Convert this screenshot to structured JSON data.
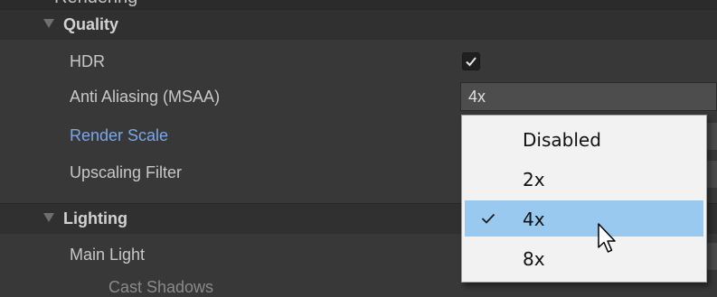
{
  "top_header": {
    "text": "Rendering"
  },
  "quality_section": {
    "title": "Quality",
    "hdr": {
      "label": "HDR",
      "checked": true
    },
    "anti_aliasing": {
      "label": "Anti Aliasing (MSAA)",
      "value": "4x"
    },
    "render_scale": {
      "label": "Render Scale"
    },
    "upscaling_filter": {
      "label": "Upscaling Filter"
    }
  },
  "lighting_section": {
    "title": "Lighting",
    "main_light": {
      "label": "Main Light"
    },
    "cast_shadows": {
      "label": "Cast Shadows"
    }
  },
  "msaa_popup": {
    "options": [
      {
        "label": "Disabled",
        "selected": false
      },
      {
        "label": "2x",
        "selected": false
      },
      {
        "label": "4x",
        "selected": true
      },
      {
        "label": "8x",
        "selected": false
      }
    ]
  },
  "colors": {
    "panel_bg": "#383838",
    "header_bg": "#303030",
    "highlight_label": "#7ba7e8",
    "popup_bg": "#f2f2f2",
    "popup_selected": "#99c9ef"
  },
  "icons": {
    "foldout": "triangle-down-icon",
    "checkmark": "checkmark-icon",
    "cursor": "mouse-pointer-icon"
  }
}
